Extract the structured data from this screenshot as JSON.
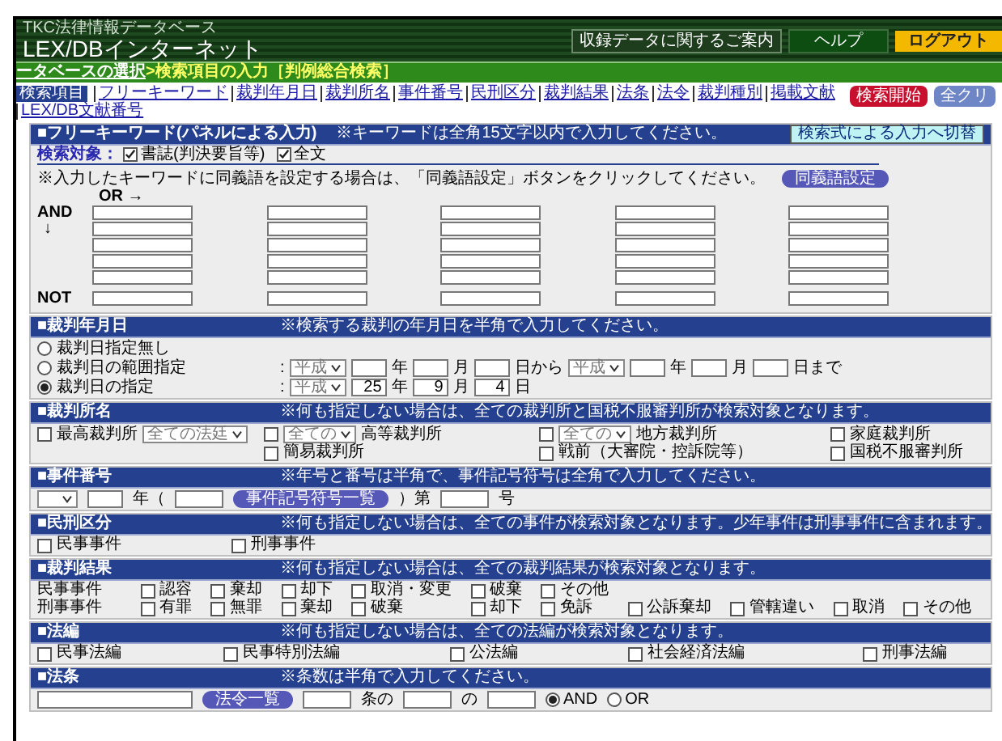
{
  "header": {
    "db_name": "TKC法律情報データベース",
    "logo": "LEX/DBインターネット",
    "buttons": [
      {
        "label": "収録データに関するご案内",
        "kind": "plain"
      },
      {
        "label": "ヘルプ",
        "kind": "dark"
      },
      {
        "label": "ログアウト",
        "kind": "accent"
      }
    ]
  },
  "breadcrumb": {
    "link": "ータベースの選択",
    "current": ">検索項目の入力［判例総合検索］"
  },
  "nav": {
    "badge": "検索項目",
    "links": [
      "フリーキーワード",
      "裁判年月日",
      "裁判所名",
      "事件番号",
      "民刑区分",
      "裁判結果",
      "法条",
      "法令",
      "裁判種別",
      "掲載文献",
      "LEX/DB文献番号"
    ],
    "actions": [
      {
        "label": "検索開始",
        "kind": "primary"
      },
      {
        "label": "全クリ",
        "kind": "secondary"
      }
    ]
  },
  "sections": [
    {
      "kind": "keywords",
      "title": "■フリーキーワード(パネルによる入力)",
      "note": "※キーワードは全角15文字以内で入力してください。",
      "button": "検索式による入力へ切替",
      "target_label": "検索対象：",
      "targets": [
        {
          "label": "書誌(判決要旨等)",
          "checked": true
        },
        {
          "label": "全文",
          "checked": true
        }
      ],
      "synonym_note": "※入力したキーワードに同義語を設定する場合は、「同義語設定」ボタンをクリックしてください。",
      "synonym_button": "同義語設定",
      "or_label": "OR →",
      "and_label": "AND",
      "arrow": "↓",
      "not_label": "NOT"
    },
    {
      "kind": "date",
      "title": "■裁判年月日",
      "note": "※検索する裁判の年月日を半角で入力してください。",
      "rows": [
        {
          "cells": [
            {
              "parts": [
                {
                  "kind": "radio",
                  "selected": false
                },
                {
                  "kind": "text",
                  "label": "裁判日指定無し"
                }
              ]
            }
          ]
        },
        {
          "cells": [
            {
              "parts": [
                {
                  "kind": "radio",
                  "selected": false
                },
                {
                  "kind": "text",
                  "label": "裁判日の範囲指定"
                }
              ]
            },
            {
              "parts": [
                {
                  "kind": "text",
                  "label": ":"
                },
                {
                  "kind": "select",
                  "value": "平成"
                },
                {
                  "kind": "input"
                },
                {
                  "kind": "text",
                  "label": "年"
                },
                {
                  "kind": "input"
                },
                {
                  "kind": "text",
                  "label": "月"
                },
                {
                  "kind": "input"
                },
                {
                  "kind": "text",
                  "label": "日から"
                },
                {
                  "kind": "select",
                  "value": "平成"
                },
                {
                  "kind": "input"
                },
                {
                  "kind": "text",
                  "label": "年"
                },
                {
                  "kind": "input"
                },
                {
                  "kind": "text",
                  "label": "月"
                },
                {
                  "kind": "input"
                },
                {
                  "kind": "text",
                  "label": "日まで"
                }
              ]
            }
          ]
        },
        {
          "cells": [
            {
              "parts": [
                {
                  "kind": "radio",
                  "selected": true
                },
                {
                  "kind": "text",
                  "label": "裁判日の指定"
                }
              ]
            },
            {
              "parts": [
                {
                  "kind": "text",
                  "label": ":"
                },
                {
                  "kind": "select",
                  "value": "平成"
                },
                {
                  "kind": "input",
                  "value": "25"
                },
                {
                  "kind": "text",
                  "label": "年"
                },
                {
                  "kind": "input",
                  "value": "9"
                },
                {
                  "kind": "text",
                  "label": "月"
                },
                {
                  "kind": "input",
                  "value": "4"
                },
                {
                  "kind": "text",
                  "label": "日"
                }
              ]
            }
          ]
        }
      ]
    },
    {
      "kind": "courts",
      "title": "■裁判所名",
      "note": "※何も指定しない場合は、全ての裁判所と国税不服審判所が検索対象となります。",
      "rows": [
        {
          "cells": [
            {
              "parts": [
                {
                  "kind": "checkbox",
                  "checked": false
                },
                {
                  "kind": "text",
                  "label": "最高裁判所"
                },
                {
                  "kind": "select",
                  "value": "全ての法廷"
                }
              ]
            },
            {
              "parts": [
                {
                  "kind": "checkbox",
                  "checked": false
                },
                {
                  "kind": "select",
                  "value": "全ての"
                },
                {
                  "kind": "text",
                  "label": "高等裁判所"
                }
              ]
            },
            {
              "parts": [
                {
                  "kind": "checkbox",
                  "checked": false
                },
                {
                  "kind": "select",
                  "value": "全ての"
                },
                {
                  "kind": "text",
                  "label": "地方裁判所"
                }
              ]
            },
            {
              "parts": [
                {
                  "kind": "checkbox",
                  "checked": false
                },
                {
                  "kind": "text",
                  "label": "家庭裁判所"
                }
              ]
            }
          ]
        },
        {
          "cells": [
            "",
            {
              "parts": [
                {
                  "kind": "checkbox",
                  "checked": false
                },
                {
                  "kind": "text",
                  "label": "簡易裁判所"
                }
              ]
            },
            {
              "parts": [
                {
                  "kind": "checkbox",
                  "checked": false
                },
                {
                  "kind": "text",
                  "label": "戦前（大審院・控訴院等）"
                }
              ]
            },
            {
              "parts": [
                {
                  "kind": "checkbox",
                  "checked": false
                },
                {
                  "kind": "text",
                  "label": "国税不服審判所"
                }
              ]
            }
          ]
        }
      ]
    },
    {
      "kind": "line",
      "title": "■事件番号",
      "note": "※年号と番号は半角で、事件記号符号は全角で入力してください。",
      "rows": [
        {
          "cells": [
            {
              "parts": [
                {
                  "kind": "select"
                },
                {
                  "kind": "input"
                },
                {
                  "kind": "text",
                  "label": "年（"
                },
                {
                  "kind": "input_wide"
                },
                {
                  "kind": "button",
                  "label": "事件記号符号一覧"
                },
                {
                  "kind": "text",
                  "label": "）第"
                },
                {
                  "kind": "input_wide"
                },
                {
                  "kind": "text",
                  "label": "号"
                }
              ]
            }
          ]
        }
      ]
    },
    {
      "kind": "checks",
      "title": "■民刑区分",
      "note": "※何も指定しない場合は、全ての事件が検索対象となります。少年事件は刑事事件に含まれます。",
      "rows": [
        {
          "cells": [
            {
              "parts": [
                {
                  "kind": "checkbox",
                  "checked": false
                },
                {
                  "kind": "text",
                  "label": "民事事件"
                }
              ]
            },
            {
              "parts": [
                {
                  "kind": "checkbox",
                  "checked": false
                },
                {
                  "kind": "text",
                  "label": "刑事事件"
                }
              ]
            }
          ]
        }
      ]
    },
    {
      "kind": "results",
      "title": "■裁判結果",
      "note": "※何も指定しない場合は、全ての裁判結果が検索対象となります。",
      "rows": [
        {
          "label": "民事事件",
          "cells": [
            {
              "parts": [
                {
                  "kind": "checkbox",
                  "checked": false
                },
                {
                  "kind": "text",
                  "label": "認容"
                }
              ]
            },
            {
              "parts": [
                {
                  "kind": "checkbox",
                  "checked": false
                },
                {
                  "kind": "text",
                  "label": "棄却"
                }
              ]
            },
            {
              "parts": [
                {
                  "kind": "checkbox",
                  "checked": false
                },
                {
                  "kind": "text",
                  "label": "却下"
                }
              ]
            },
            {
              "parts": [
                {
                  "kind": "checkbox",
                  "checked": false
                },
                {
                  "kind": "text",
                  "label": "取消・変更"
                }
              ]
            },
            {
              "parts": [
                {
                  "kind": "checkbox",
                  "checked": false
                },
                {
                  "kind": "text",
                  "label": "破棄"
                }
              ]
            },
            {
              "parts": [
                {
                  "kind": "checkbox",
                  "checked": false
                },
                {
                  "kind": "text",
                  "label": "その他"
                }
              ]
            }
          ]
        },
        {
          "label": "刑事事件",
          "cells": [
            {
              "parts": [
                {
                  "kind": "checkbox",
                  "checked": false
                },
                {
                  "kind": "text",
                  "label": "有罪"
                }
              ]
            },
            {
              "parts": [
                {
                  "kind": "checkbox",
                  "checked": false
                },
                {
                  "kind": "text",
                  "label": "無罪"
                }
              ]
            },
            {
              "parts": [
                {
                  "kind": "checkbox",
                  "checked": false
                },
                {
                  "kind": "text",
                  "label": "棄却"
                }
              ]
            },
            {
              "parts": [
                {
                  "kind": "checkbox",
                  "checked": false
                },
                {
                  "kind": "text",
                  "label": "破棄"
                }
              ]
            },
            {
              "parts": [
                {
                  "kind": "checkbox",
                  "checked": false
                },
                {
                  "kind": "text",
                  "label": "却下"
                }
              ]
            },
            {
              "parts": [
                {
                  "kind": "checkbox",
                  "checked": false
                },
                {
                  "kind": "text",
                  "label": "免訴"
                }
              ]
            },
            {
              "parts": [
                {
                  "kind": "checkbox",
                  "checked": false
                },
                {
                  "kind": "text",
                  "label": "公訴棄却"
                }
              ]
            },
            {
              "parts": [
                {
                  "kind": "checkbox",
                  "checked": false
                },
                {
                  "kind": "text",
                  "label": "管轄違い"
                }
              ]
            },
            {
              "parts": [
                {
                  "kind": "checkbox",
                  "checked": false
                },
                {
                  "kind": "text",
                  "label": "取消"
                }
              ]
            },
            {
              "parts": [
                {
                  "kind": "checkbox",
                  "checked": false
                },
                {
                  "kind": "text",
                  "label": "その他"
                }
              ]
            }
          ]
        }
      ]
    },
    {
      "kind": "checks",
      "title": "■法編",
      "note": "※何も指定しない場合は、全ての法編が検索対象となります。",
      "rows": [
        {
          "cells": [
            {
              "parts": [
                {
                  "kind": "checkbox",
                  "checked": false
                },
                {
                  "kind": "text",
                  "label": "民事法編"
                }
              ]
            },
            {
              "parts": [
                {
                  "kind": "checkbox",
                  "checked": false
                },
                {
                  "kind": "text",
                  "label": "民事特別法編"
                }
              ]
            },
            {
              "parts": [
                {
                  "kind": "checkbox",
                  "checked": false
                },
                {
                  "kind": "text",
                  "label": "公法編"
                }
              ]
            },
            {
              "parts": [
                {
                  "kind": "checkbox",
                  "checked": false
                },
                {
                  "kind": "text",
                  "label": "社会経済法編"
                }
              ]
            },
            {
              "parts": [
                {
                  "kind": "checkbox",
                  "checked": false
                },
                {
                  "kind": "text",
                  "label": "刑事法編"
                }
              ]
            }
          ]
        }
      ]
    },
    {
      "kind": "line",
      "title": "■法条",
      "note": "※条数は半角で入力してください。",
      "rows": [
        {
          "cells": [
            {
              "parts": [
                {
                  "kind": "input_long"
                },
                {
                  "kind": "button",
                  "label": "法令一覧"
                },
                {
                  "kind": "input_wide"
                },
                {
                  "kind": "text",
                  "label": "条の"
                },
                {
                  "kind": "input_wide"
                },
                {
                  "kind": "text",
                  "label": "の"
                },
                {
                  "kind": "input_wide"
                },
                {
                  "kind": "radio",
                  "selected": true,
                  "label": "AND"
                },
                {
                  "kind": "radio",
                  "selected": false,
                  "label": "OR"
                }
              ]
            }
          ]
        }
      ]
    }
  ]
}
